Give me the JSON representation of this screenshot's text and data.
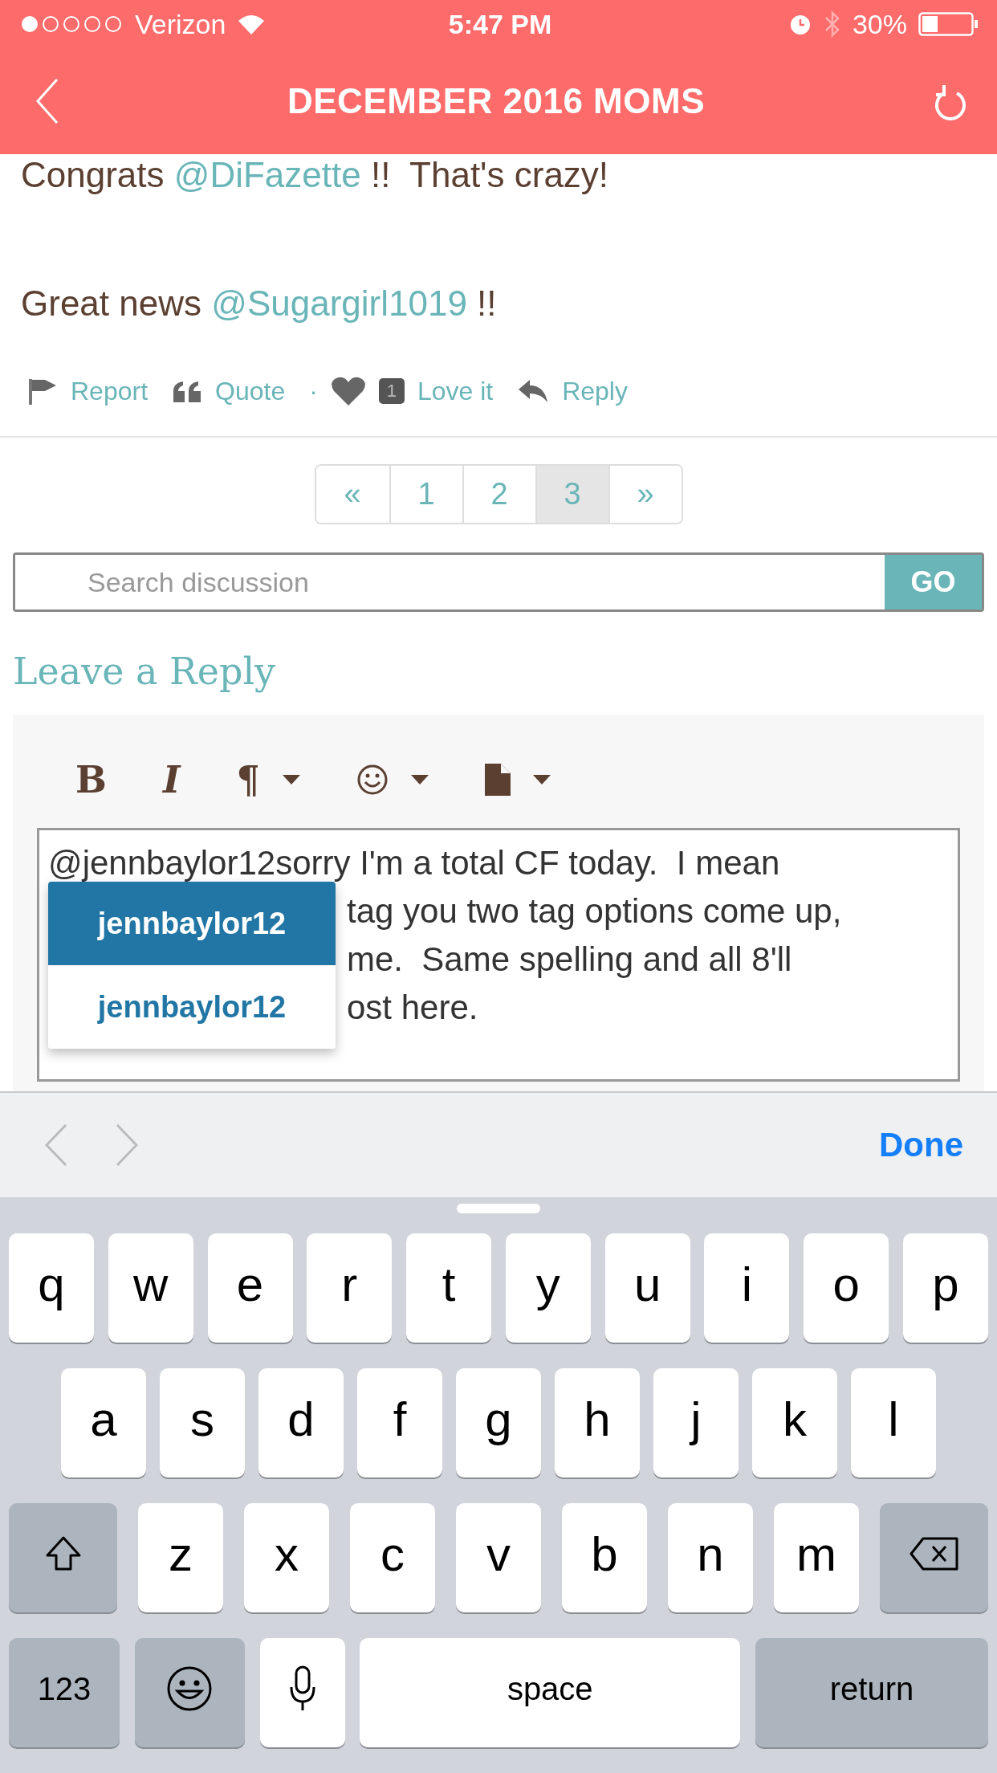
{
  "status_bar": {
    "carrier": "Verizon",
    "time": "5:47 PM",
    "battery": "30%"
  },
  "header": {
    "title": "DECEMBER 2016 MOMS"
  },
  "post": {
    "paragraphs": [
      [
        {
          "kind": "plain",
          "text": "Congrats "
        },
        {
          "kind": "mention",
          "text": "@DiFazette"
        },
        {
          "kind": "plain",
          "text": " !!  That's crazy!"
        }
      ],
      [
        {
          "kind": "plain",
          "text": "Great news "
        },
        {
          "kind": "mention",
          "text": "@Sugargirl1019"
        },
        {
          "kind": "plain",
          "text": " !!"
        }
      ]
    ],
    "actions": [
      {
        "kind": "report",
        "label": "Report"
      },
      {
        "kind": "quote",
        "label": "Quote"
      },
      {
        "kind": "separator",
        "label": "·"
      },
      {
        "kind": "love",
        "label": "Love it",
        "count": "1"
      },
      {
        "kind": "reply",
        "label": "Reply"
      }
    ]
  },
  "pagination": [
    {
      "label": "«",
      "selected": false
    },
    {
      "label": "1",
      "selected": false
    },
    {
      "label": "2",
      "selected": false
    },
    {
      "label": "3",
      "selected": true
    },
    {
      "label": "»",
      "selected": false
    }
  ],
  "search": {
    "placeholder": "Search discussion",
    "button": "GO"
  },
  "reply": {
    "title": "Leave a Reply",
    "toolbar": [
      {
        "kind": "bold",
        "label": "B",
        "dropdown": false
      },
      {
        "kind": "italic",
        "label": "I",
        "dropdown": false
      },
      {
        "kind": "paragraph",
        "label": "¶",
        "dropdown": true
      },
      {
        "kind": "emoji",
        "dropdown": true
      },
      {
        "kind": "document",
        "dropdown": true
      }
    ],
    "editor_lines": [
      "@jennbaylor12sorry I'm a total CF today.  I mean",
      "tag you two tag options come up,",
      "me.  Same spelling and all 8'll",
      "ost here."
    ],
    "mention_menu": [
      {
        "label": "jennbaylor12",
        "selected": true
      },
      {
        "label": "jennbaylor12",
        "selected": false
      }
    ]
  },
  "accessory_bar": {
    "done": "Done"
  },
  "keyboard": {
    "rows": [
      {
        "keys": [
          {
            "kind": "letter",
            "label": "q"
          },
          {
            "kind": "letter",
            "label": "w"
          },
          {
            "kind": "letter",
            "label": "e"
          },
          {
            "kind": "letter",
            "label": "r"
          },
          {
            "kind": "letter",
            "label": "t"
          },
          {
            "kind": "letter",
            "label": "y"
          },
          {
            "kind": "letter",
            "label": "u"
          },
          {
            "kind": "letter",
            "label": "i"
          },
          {
            "kind": "letter",
            "label": "o"
          },
          {
            "kind": "letter",
            "label": "p"
          }
        ]
      },
      {
        "keys": [
          {
            "kind": "letter",
            "label": "a"
          },
          {
            "kind": "letter",
            "label": "s"
          },
          {
            "kind": "letter",
            "label": "d"
          },
          {
            "kind": "letter",
            "label": "f"
          },
          {
            "kind": "letter",
            "label": "g"
          },
          {
            "kind": "letter",
            "label": "h"
          },
          {
            "kind": "letter",
            "label": "j"
          },
          {
            "kind": "letter",
            "label": "k"
          },
          {
            "kind": "letter",
            "label": "l"
          }
        ]
      },
      {
        "keys": [
          {
            "kind": "shift"
          },
          {
            "kind": "letter",
            "label": "z"
          },
          {
            "kind": "letter",
            "label": "x"
          },
          {
            "kind": "letter",
            "label": "c"
          },
          {
            "kind": "letter",
            "label": "v"
          },
          {
            "kind": "letter",
            "label": "b"
          },
          {
            "kind": "letter",
            "label": "n"
          },
          {
            "kind": "letter",
            "label": "m"
          },
          {
            "kind": "delete"
          }
        ]
      },
      {
        "keys": [
          {
            "kind": "mode",
            "label": "123"
          },
          {
            "kind": "emoji"
          },
          {
            "kind": "mic"
          },
          {
            "kind": "space",
            "label": "space"
          },
          {
            "kind": "return",
            "label": "return"
          }
        ]
      }
    ]
  }
}
